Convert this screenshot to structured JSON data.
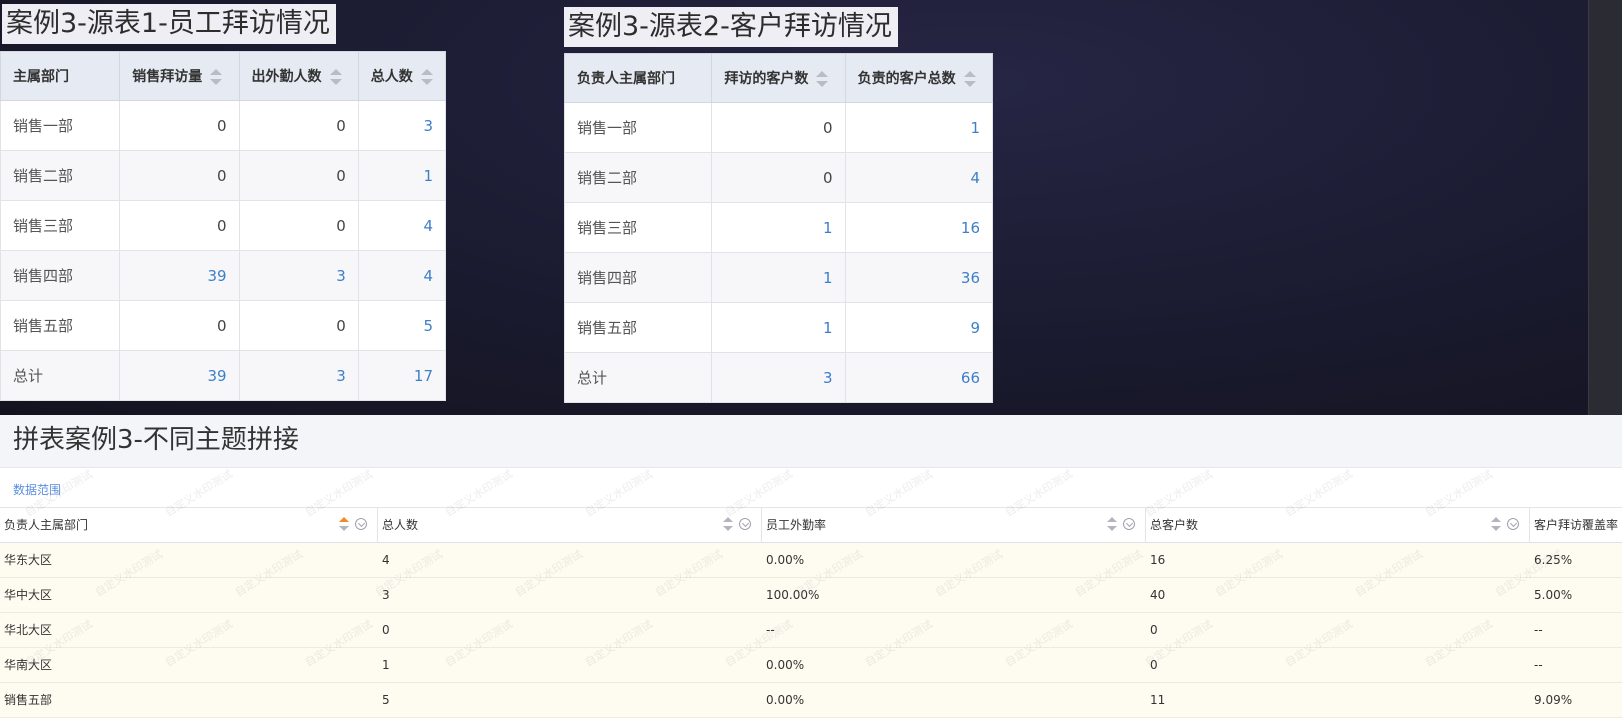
{
  "source1": {
    "title": "案例3-源表1-员工拜访情况",
    "headers": [
      "主属部门",
      "销售拜访量",
      "出外勤人数",
      "总人数"
    ],
    "rows": [
      [
        "销售一部",
        "0",
        "0",
        "3"
      ],
      [
        "销售二部",
        "0",
        "0",
        "1"
      ],
      [
        "销售三部",
        "0",
        "0",
        "4"
      ],
      [
        "销售四部",
        "39",
        "3",
        "4"
      ],
      [
        "销售五部",
        "0",
        "0",
        "5"
      ],
      [
        "总计",
        "39",
        "3",
        "17"
      ]
    ]
  },
  "source2": {
    "title": "案例3-源表2-客户拜访情况",
    "headers": [
      "负责人主属部门",
      "拜访的客户数",
      "负责的客户总数"
    ],
    "rows": [
      [
        "销售一部",
        "0",
        "1"
      ],
      [
        "销售二部",
        "0",
        "4"
      ],
      [
        "销售三部",
        "1",
        "16"
      ],
      [
        "销售四部",
        "1",
        "36"
      ],
      [
        "销售五部",
        "1",
        "9"
      ],
      [
        "总计",
        "3",
        "66"
      ]
    ]
  },
  "report": {
    "title": "拼表案例3-不同主题拼接",
    "filter_link": "数据范围",
    "headers": [
      "负责人主属部门",
      "总人数",
      "员工外勤率",
      "总客户数",
      "客户拜访覆盖率"
    ],
    "rows": [
      [
        "华东大区",
        "4",
        "0.00%",
        "16",
        "6.25%"
      ],
      [
        "华中大区",
        "3",
        "100.00%",
        "40",
        "5.00%"
      ],
      [
        "华北大区",
        "0",
        "--",
        "0",
        "--"
      ],
      [
        "华南大区",
        "1",
        "0.00%",
        "0",
        "--"
      ],
      [
        "销售五部",
        "5",
        "0.00%",
        "11",
        "9.09%"
      ]
    ],
    "watermark_text": "自定义水印测试"
  }
}
